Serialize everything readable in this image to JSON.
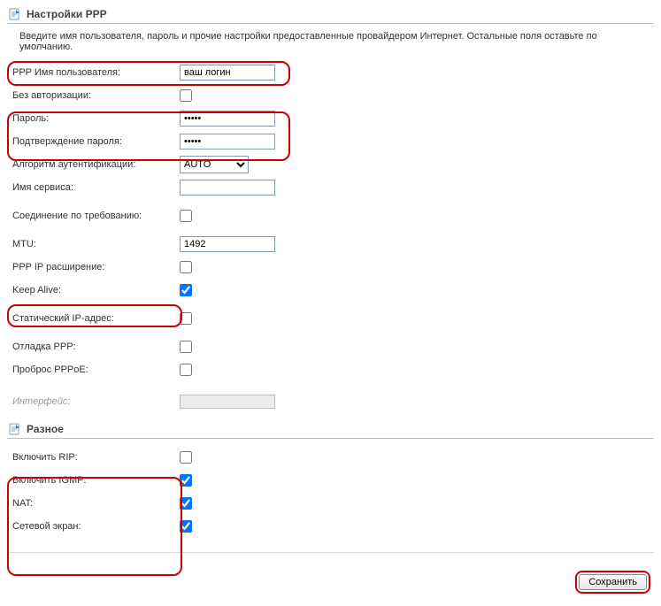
{
  "sections": {
    "ppp": {
      "title": "Настройки PPP",
      "hint": "Введите имя пользователя, пароль и прочие настройки предоставленные провайдером Интернет. Остальные поля оставьте по умолчанию.",
      "rows": {
        "username": {
          "label": "PPP Имя пользователя:",
          "value": "ваш логин"
        },
        "no_auth": {
          "label": "Без авторизации:",
          "checked": false
        },
        "password": {
          "label": "Пароль:",
          "value": "•••••"
        },
        "password_confirm": {
          "label": "Подтверждение пароля:",
          "value": "•••••"
        },
        "auth_algo": {
          "label": "Алгоритм аутентификации:",
          "value": "AUTO",
          "options": [
            "AUTO"
          ]
        },
        "service_name": {
          "label": "Имя сервиса:",
          "value": ""
        },
        "dial_on_demand": {
          "label": "Соединение по требованию:",
          "checked": false
        },
        "mtu": {
          "label": "MTU:",
          "value": "1492"
        },
        "ppp_ip_ext": {
          "label": "PPP IP расширение:",
          "checked": false
        },
        "keep_alive": {
          "label": "Keep Alive:",
          "checked": true
        },
        "static_ip": {
          "label": "Статический IP-адрес:",
          "checked": false
        },
        "debug_ppp": {
          "label": "Отладка PPP:",
          "checked": false
        },
        "pppoe_passthrough": {
          "label": "Проброс PPPoE:",
          "checked": false
        },
        "interface": {
          "label": "Интерфейс:",
          "value": ""
        }
      }
    },
    "misc": {
      "title": "Разное",
      "rows": {
        "rip": {
          "label": "Включить RIP:",
          "checked": false
        },
        "igmp": {
          "label": "Включить IGMP:",
          "checked": true
        },
        "nat": {
          "label": "NAT:",
          "checked": true
        },
        "firewall": {
          "label": "Сетевой экран:",
          "checked": true
        }
      }
    }
  },
  "buttons": {
    "save": "Сохранить"
  }
}
